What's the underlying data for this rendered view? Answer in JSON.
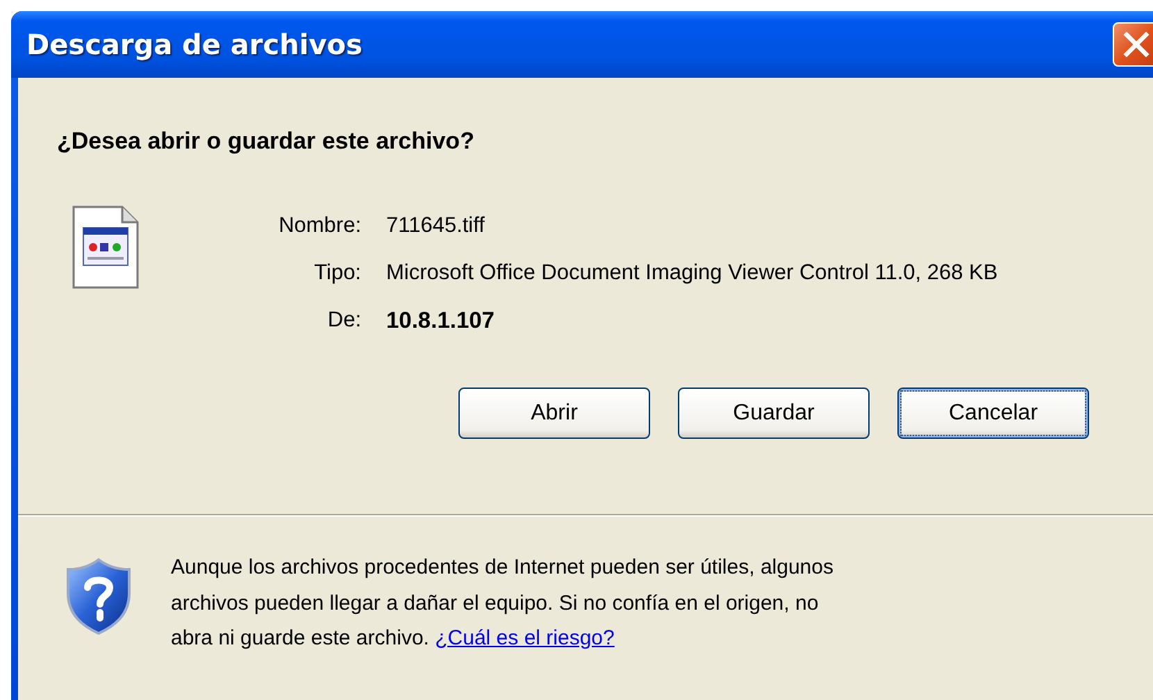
{
  "window": {
    "title": "Descarga de archivos"
  },
  "question": "¿Desea abrir o guardar este archivo?",
  "fields": [
    {
      "label": "Nombre:",
      "value": "711645.tiff",
      "bold": false
    },
    {
      "label": "Tipo:",
      "value": "Microsoft Office Document Imaging Viewer Control 11.0, 268 KB",
      "bold": false
    },
    {
      "label": "De:",
      "value": "10.8.1.107",
      "bold": true
    }
  ],
  "buttons": [
    {
      "label": "Abrir",
      "focused": false
    },
    {
      "label": "Guardar",
      "focused": false
    },
    {
      "label": "Cancelar",
      "focused": true
    }
  ],
  "warning": {
    "text": "Aunque los archivos procedentes de Internet pueden ser útiles, algunos archivos pueden llegar a dañar el equipo. Si no confía en el origen, no abra ni guarde este archivo.",
    "link": "¿Cuál es el riesgo?"
  }
}
